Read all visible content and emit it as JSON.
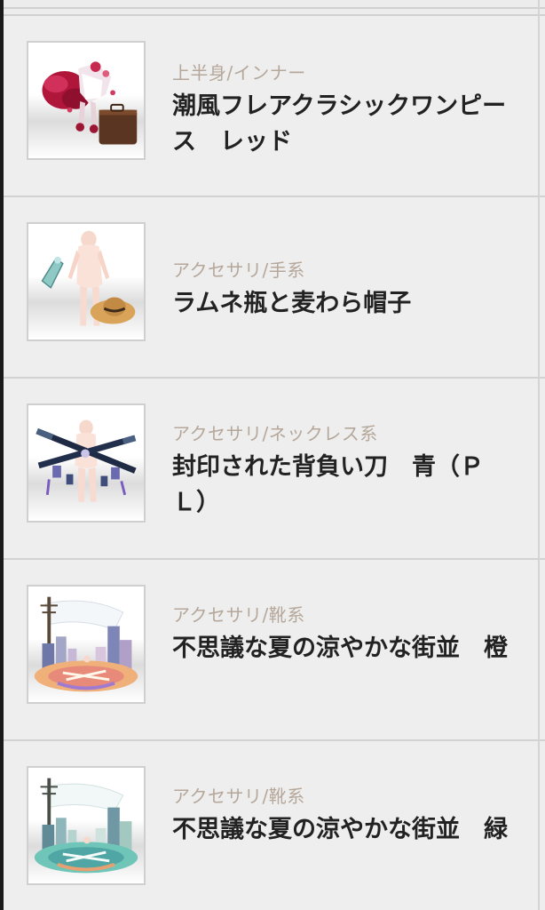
{
  "items": [
    {
      "category": "上半身/インナー",
      "title": "潮風フレアクラシックワンピース　レッド",
      "thumb_icon": "red-dress-with-suitcase-icon"
    },
    {
      "category": "アクセサリ/手系",
      "title": "ラムネ瓶と麦わら帽子",
      "thumb_icon": "ramune-bottle-straw-hat-icon"
    },
    {
      "category": "アクセサリ/ネックレス系",
      "title": "封印された背負い刀　青（ＰＬ）",
      "thumb_icon": "sealed-swords-icon"
    },
    {
      "category": "アクセサリ/靴系",
      "title": "不思議な夏の涼やかな街並　橙",
      "thumb_icon": "summer-street-orange-icon"
    },
    {
      "category": "アクセサリ/靴系",
      "title": "不思議な夏の涼やかな街並　緑",
      "thumb_icon": "summer-street-green-icon"
    }
  ],
  "colors": {
    "background": "#ececec",
    "category_text": "#b5a79a",
    "title_text": "#222222",
    "divider": "#d2d2d2"
  }
}
